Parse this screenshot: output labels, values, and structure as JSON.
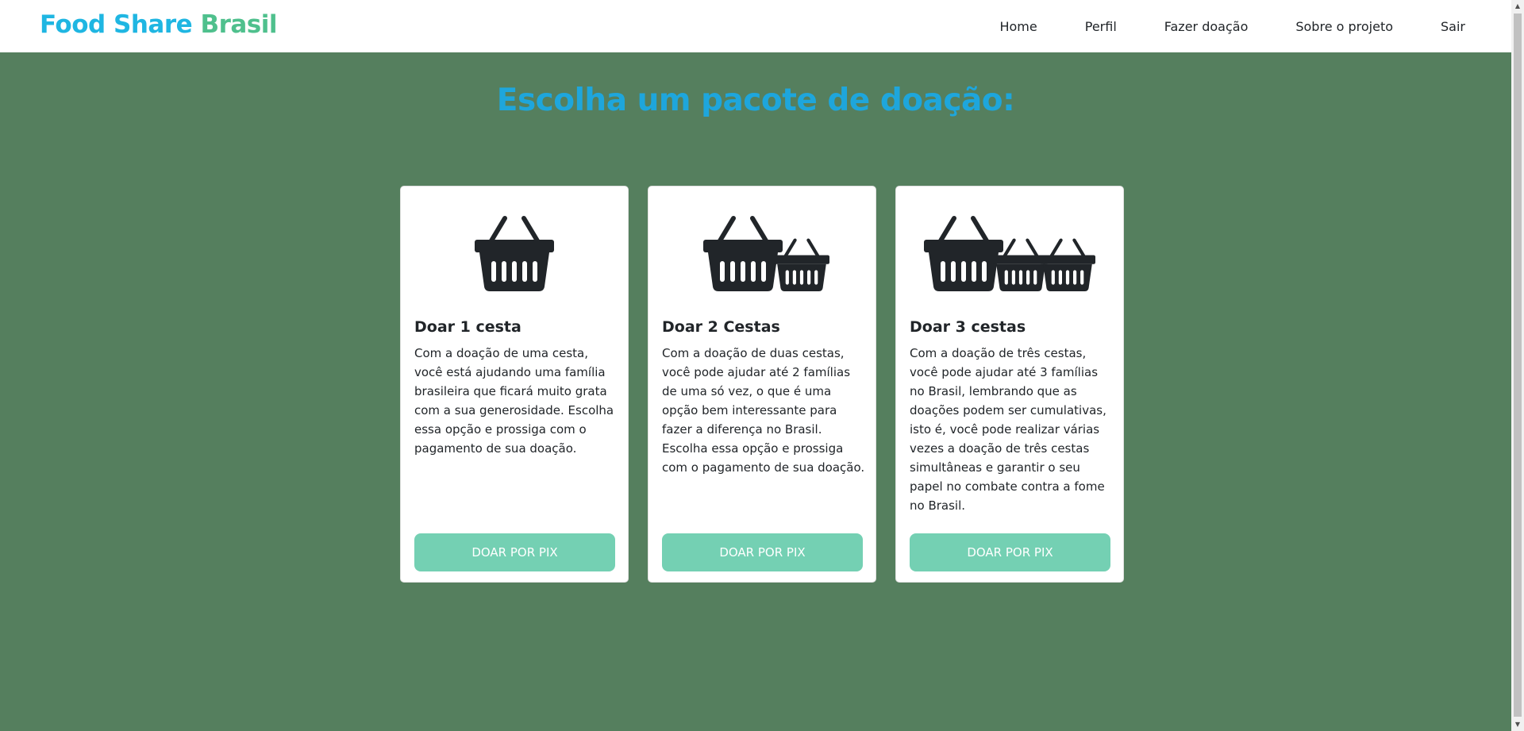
{
  "brand": {
    "part1": "Food Share",
    "part2": "Brasil"
  },
  "nav": {
    "items": [
      {
        "label": "Home"
      },
      {
        "label": "Perfil"
      },
      {
        "label": "Fazer doação"
      },
      {
        "label": "Sobre o projeto"
      },
      {
        "label": "Sair"
      }
    ]
  },
  "heading": "Escolha um pacote de doação:",
  "cards": [
    {
      "icon": "shopping-basket-icon",
      "baskets": 1,
      "title": "Doar 1 cesta",
      "text": "Com a doação de uma cesta, você está ajudando uma família brasileira que ficará muito grata com a sua generosidade. Escolha essa opção e prossiga com o pagamento de sua doação.",
      "button": "Doar por Pix"
    },
    {
      "icon": "shopping-basket-icon",
      "baskets": 2,
      "title": "Doar 2 Cestas",
      "text": "Com a doação de duas cestas, você pode ajudar até 2 famílias de uma só vez, o que é uma opção bem interessante para fazer a diferença no Brasil. Escolha essa opção e prossiga com o pagamento de sua doação.",
      "button": "Doar por Pix"
    },
    {
      "icon": "shopping-basket-icon",
      "baskets": 3,
      "title": "Doar 3 cestas",
      "text": "Com a doação de três cestas, você pode ajudar até 3 famílias no Brasil, lembrando que as doações podem ser cumulativas, isto é, você pode realizar várias vezes a doação de três cestas simultâneas e garantir o seu papel no combate contra a fome no Brasil.",
      "button": "Doar por Pix"
    }
  ],
  "colors": {
    "background": "#557f5e",
    "brand_blue": "#1fb6e2",
    "brand_green": "#4fc08d",
    "heading": "#1ea6dc",
    "button": "#74d0b3"
  }
}
